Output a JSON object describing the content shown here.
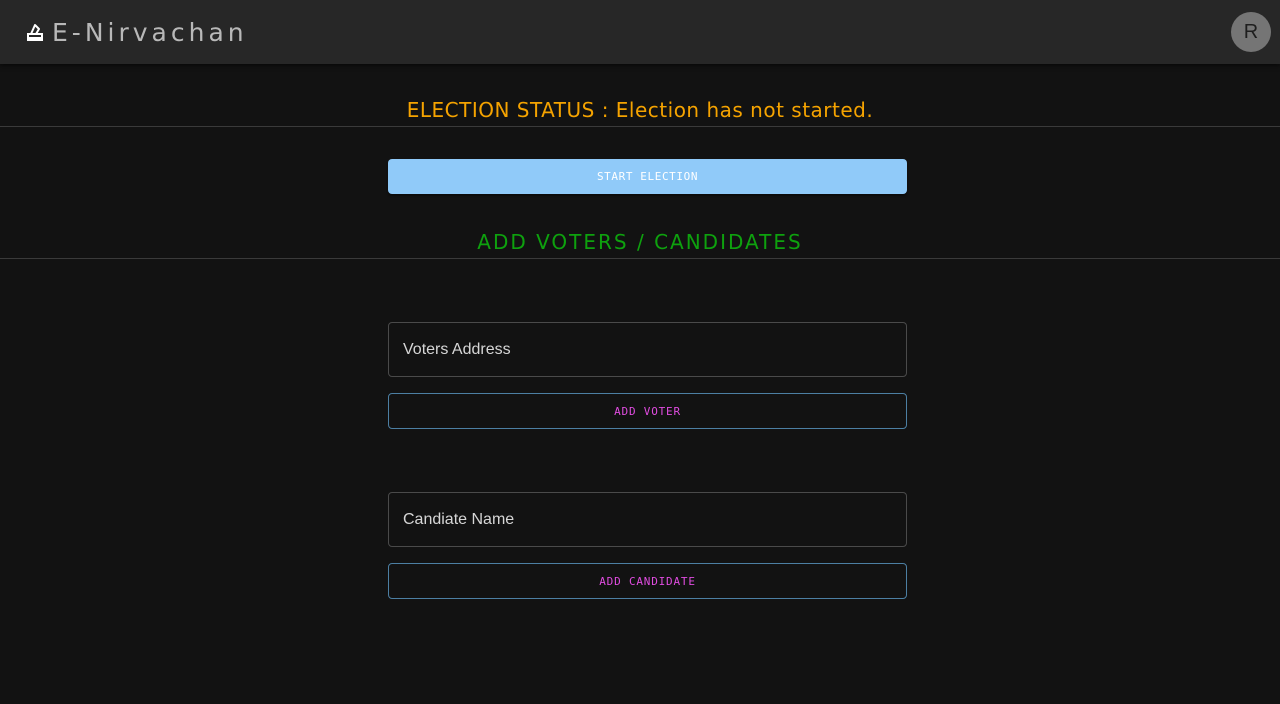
{
  "app": {
    "title": "E-Nirvachan",
    "icon": "ballot-box-icon"
  },
  "user": {
    "avatar_initial": "R"
  },
  "status": {
    "text": "ELECTION STATUS : Election has not started."
  },
  "actions": {
    "start_election_label": "START ELECTION"
  },
  "section": {
    "title": "ADD VOTERS / CANDIDATES"
  },
  "voter": {
    "placeholder": "Voters Address",
    "value": "",
    "button_label": "ADD VOTER"
  },
  "candidate": {
    "placeholder": "Candiate Name",
    "value": "",
    "button_label": "ADD CANDIDATE"
  },
  "colors": {
    "status": "#f5a300",
    "section_title": "#0ea10e",
    "primary_button": "#90caf9",
    "outline_button_text": "#e04ce0",
    "outline_button_border": "#4c7fa3",
    "background": "#121212",
    "topbar": "#272727"
  }
}
